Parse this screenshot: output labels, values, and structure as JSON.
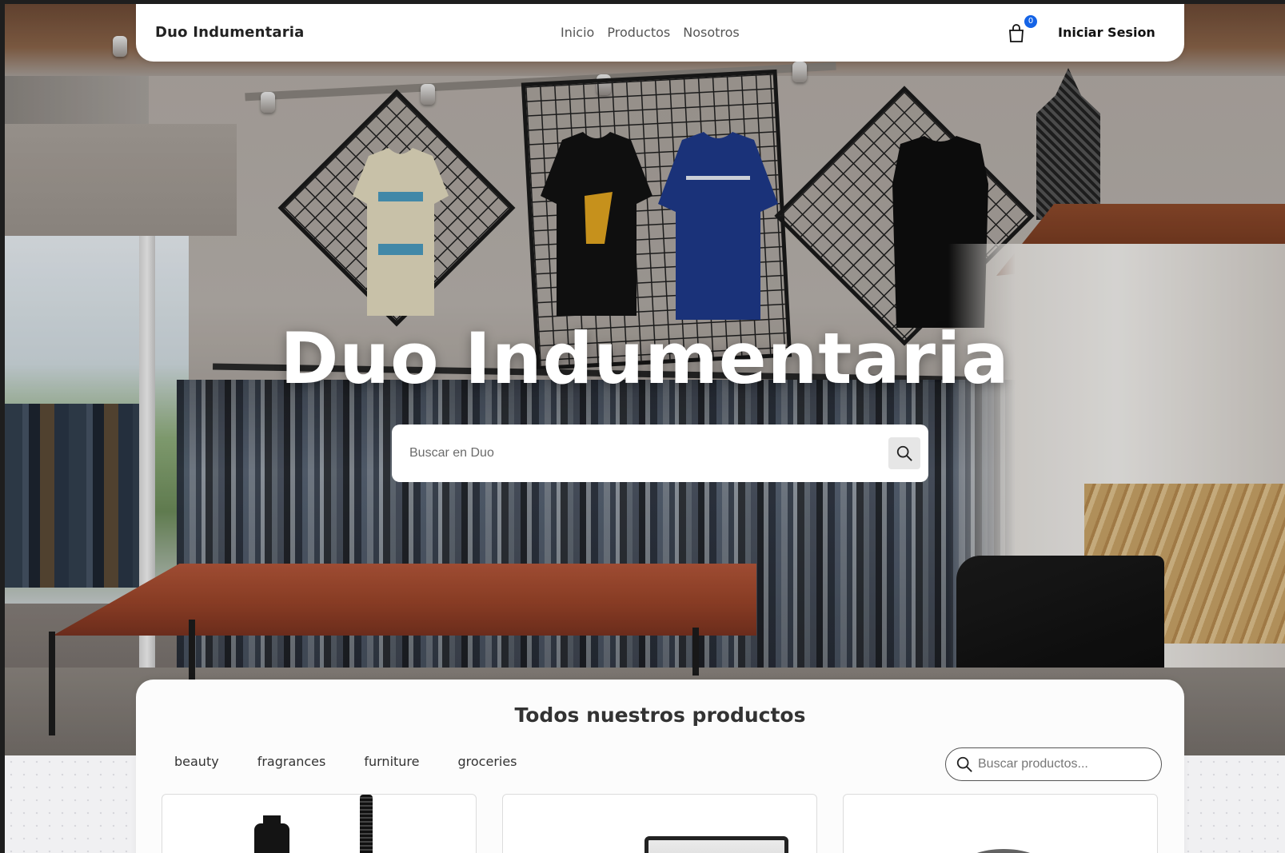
{
  "navbar": {
    "brand": "Duo Indumentaria",
    "links": [
      "Inicio",
      "Productos",
      "Nosotros"
    ],
    "cart_count": "0",
    "login_label": "Iniciar Sesion"
  },
  "hero": {
    "title": "Duo Indumentaria",
    "search_placeholder": "Buscar en Duo"
  },
  "products": {
    "title": "Todos nuestros productos",
    "categories": [
      "beauty",
      "fragrances",
      "furniture",
      "groceries"
    ],
    "search_placeholder": "Buscar productos..."
  },
  "colors": {
    "badge": "#1463e6",
    "text_dark": "#222222",
    "panel_bg": "#fcfcfc"
  },
  "icons": {
    "cart": "shopping-bag-icon",
    "search": "magnifier-icon"
  }
}
